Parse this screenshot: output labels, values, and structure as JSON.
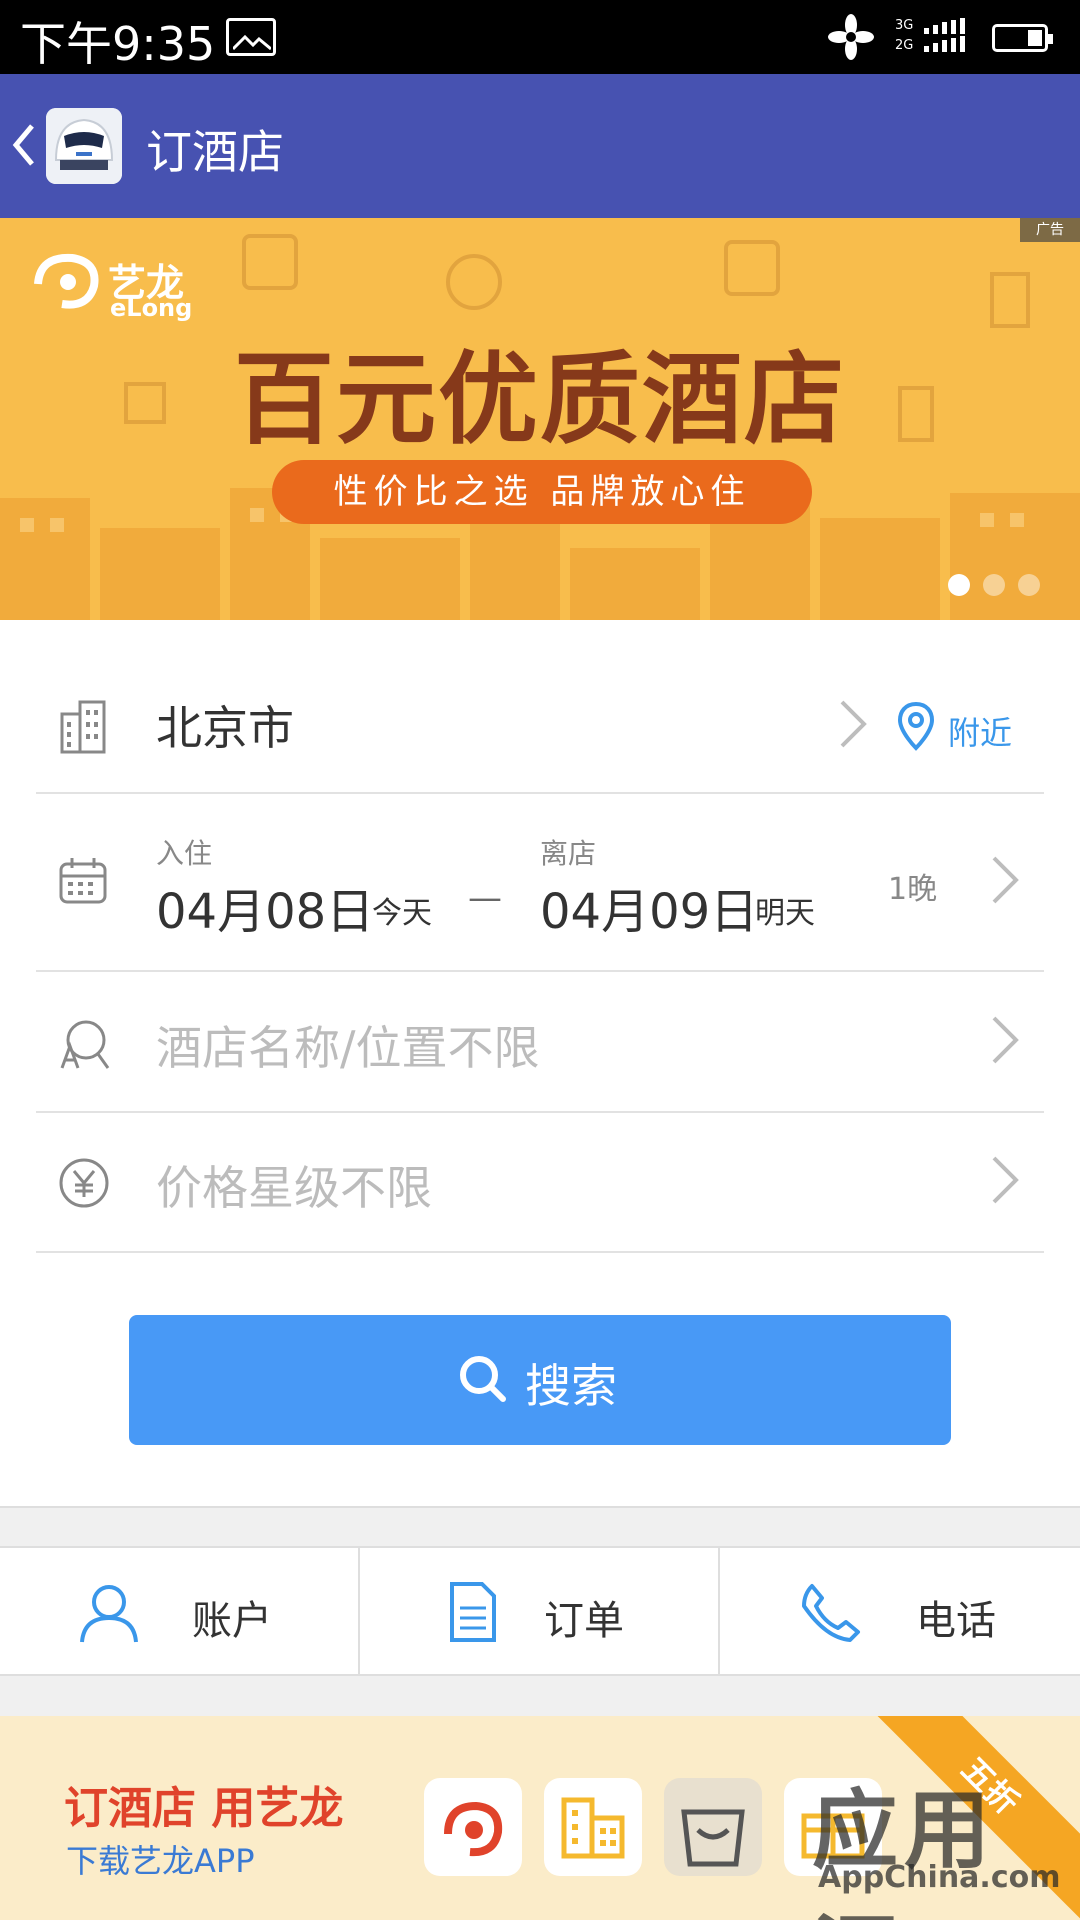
{
  "status_bar": {
    "time": "下午9:35",
    "signal_1": "3G",
    "signal_2": "2G"
  },
  "header": {
    "title": "订酒店"
  },
  "banner": {
    "ad_tag": "广告",
    "logo_cn": "艺龙",
    "logo_en": "eLong",
    "headline": "百元优质酒店",
    "subline": "性价比之选 品牌放心住",
    "active_slide": 1,
    "slide_count": 3
  },
  "search_form": {
    "city": "北京市",
    "nearby_label": "附近",
    "checkin": {
      "caption": "入住",
      "date": "04月08日",
      "day": "今天"
    },
    "separator": "—",
    "checkout": {
      "caption": "离店",
      "date": "04月09日",
      "day": "明天"
    },
    "nights": "1晚",
    "keyword_placeholder": "酒店名称/位置不限",
    "price_placeholder": "价格星级不限",
    "search_label": "搜索"
  },
  "bottom_nav": {
    "items": [
      {
        "label": "账户",
        "icon": "user-icon"
      },
      {
        "label": "订单",
        "icon": "document-icon"
      },
      {
        "label": "电话",
        "icon": "phone-icon"
      }
    ]
  },
  "bottom_ad": {
    "title": "订酒店 用艺龙",
    "subtitle": "下载艺龙APP",
    "ribbon": "五折",
    "watermark_cn": "应用汇",
    "watermark_en": "AppChina.com"
  },
  "colors": {
    "header_bg": "#4752b1",
    "banner_bg": "#f8bd4c",
    "headline": "#86391a",
    "pill": "#ea6a1c",
    "accent_blue": "#4899f6",
    "link_blue": "#3a97ea"
  }
}
